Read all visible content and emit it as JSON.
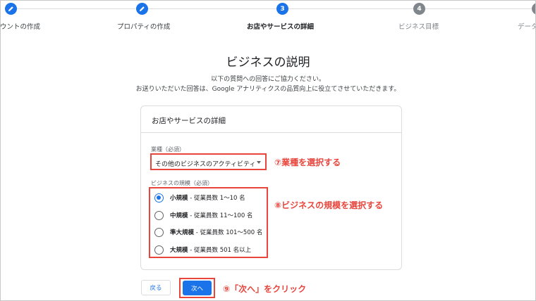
{
  "stepper": {
    "steps": [
      {
        "number": "",
        "label": "ウントの作成",
        "state": "done",
        "icon": "pencil-icon"
      },
      {
        "number": "",
        "label": "プロパティの作成",
        "state": "done",
        "icon": "pencil-icon"
      },
      {
        "number": "3",
        "label": "お店やサービスの詳細",
        "state": "active"
      },
      {
        "number": "4",
        "label": "ビジネス目標",
        "state": "todo"
      },
      {
        "number": "",
        "label": "データ",
        "state": "todo"
      }
    ]
  },
  "page": {
    "title": "ビジネスの説明",
    "subtitle_line1": "以下の質問への回答にご協力ください。",
    "subtitle_line2": "お送りいただいた回答は、Google アナリティクスの品質向上に役立てさせていただきます。"
  },
  "card": {
    "title": "お店やサービスの詳細",
    "industry": {
      "label": "業種（必須）",
      "value": "その他のビジネスのアクティビティ"
    },
    "size": {
      "label": "ビジネスの規模（必須）",
      "options": [
        {
          "bold": "小規模",
          "rest": " - 従業員数 1〜10 名",
          "checked": true
        },
        {
          "bold": "中規模",
          "rest": " - 従業員数 11〜100 名",
          "checked": false
        },
        {
          "bold": "準大規模",
          "rest": " - 従業員数 101〜500 名",
          "checked": false
        },
        {
          "bold": "大規模",
          "rest": " - 従業員数 501 名以上",
          "checked": false
        }
      ]
    }
  },
  "buttons": {
    "back": "戻る",
    "next": "次へ"
  },
  "annotations": {
    "step7": "⑦業種を選択する",
    "step8": "⑧ビジネスの規模を選択する",
    "step9": "⑨「次へ」をクリック"
  },
  "colors": {
    "accent": "#1a73e8",
    "annotation": "#e8453c",
    "inactive": "#80868b"
  }
}
